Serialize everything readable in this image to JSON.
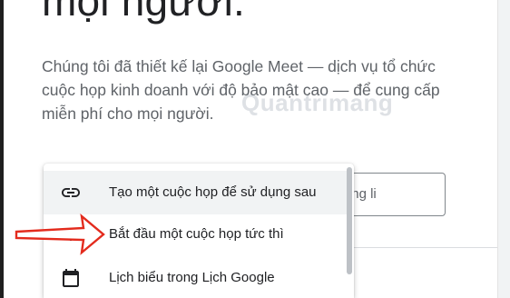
{
  "page": {
    "heading": "mọi người.",
    "description": "Chúng tôi đã thiết kế lại Google Meet — dịch vụ tổ chức cuộc họp kinh doanh với độ bảo mật cao — để cung cấp miễn phí cho mọi người.",
    "link_input_text": "ặc đường li"
  },
  "menu": {
    "items": [
      {
        "label": "Tạo một cuộc họp để sử dụng sau",
        "icon": "link-icon"
      },
      {
        "label": "Bắt đầu một cuộc họp tức thì",
        "icon": "plus-icon"
      },
      {
        "label": "Lịch biểu trong Lịch Google",
        "icon": "calendar-icon"
      }
    ]
  },
  "watermark": "Quantrimang",
  "colors": {
    "arrow": "#e32b1d",
    "menu_hover": "#f1f3f4",
    "text": "#202124",
    "secondary_text": "#5f6368"
  }
}
